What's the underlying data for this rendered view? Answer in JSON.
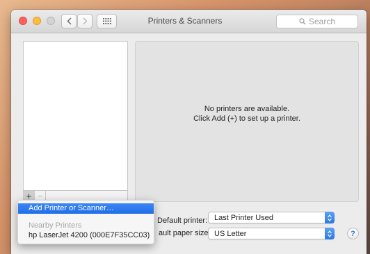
{
  "window": {
    "title": "Printers & Scanners",
    "search_placeholder": "Search"
  },
  "printer_list": {
    "add_label": "+",
    "remove_label": "−"
  },
  "detail": {
    "empty_line1": "No printers are available.",
    "empty_line2": "Click Add (+) to set up a printer."
  },
  "settings": {
    "default_printer_label": "Default printer:",
    "default_printer_value": "Last Printer Used",
    "paper_size_label": "ault paper size:",
    "paper_size_value": "US Letter",
    "help_label": "?"
  },
  "add_menu": {
    "items": [
      {
        "label": "Add Printer or Scanner…",
        "highlighted": true
      }
    ],
    "section_header": "Nearby Printers",
    "nearby": [
      {
        "label": "hp LaserJet 4200 (000E7F35CC03)"
      }
    ]
  },
  "colors": {
    "accent": "#2f7bf0",
    "close": "#fc615d",
    "minimize": "#fdbc40",
    "zoom_disabled": "#d3d3d3"
  }
}
